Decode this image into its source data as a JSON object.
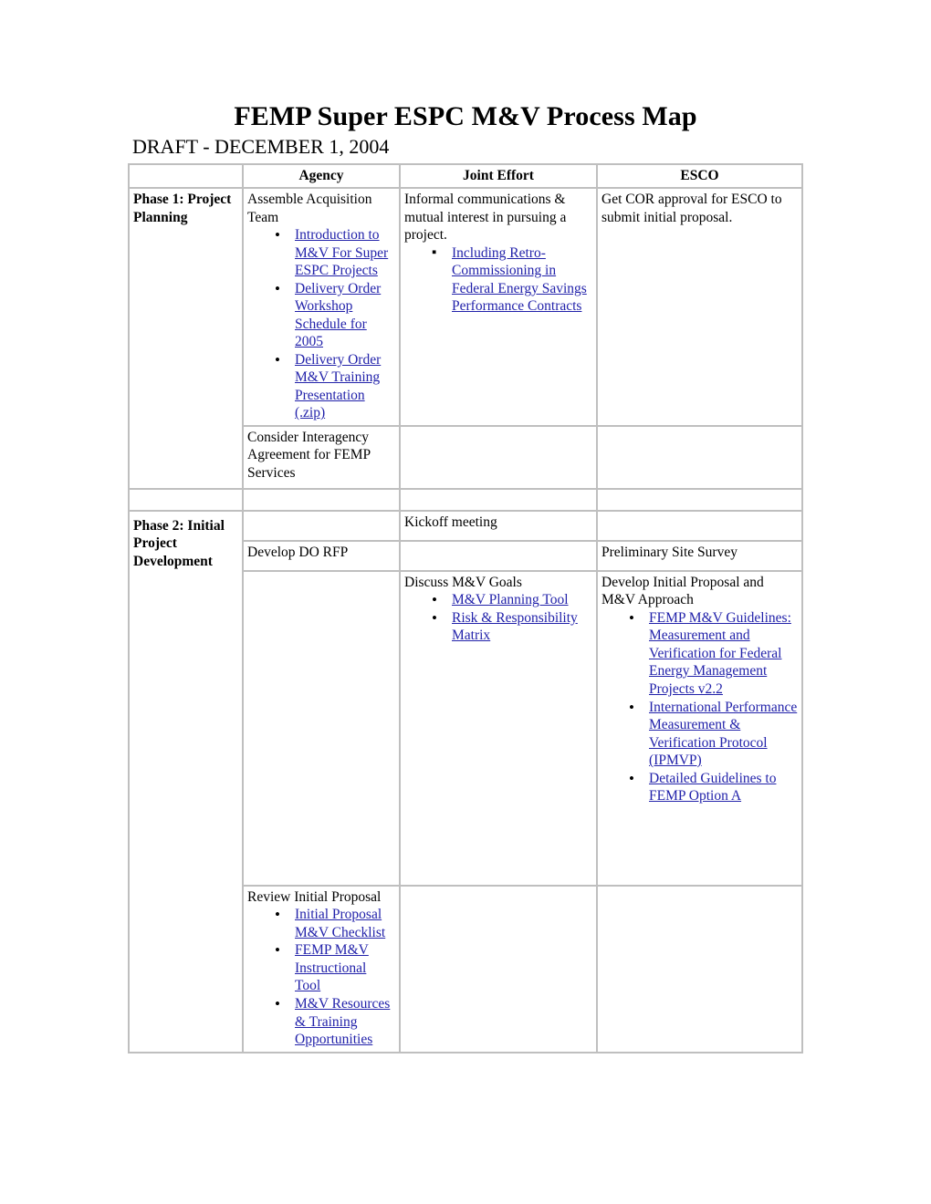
{
  "document": {
    "title": "FEMP Super ESPC M&V Process Map",
    "subtitle": "DRAFT - DECEMBER 1, 2004"
  },
  "colors": {
    "joint_effort_fill": "#ccffff",
    "divider_fill": "#c0c0c0",
    "link": "#2222aa",
    "border": "#bfbfbf"
  },
  "table": {
    "headers": {
      "phase": "",
      "agency": "Agency",
      "joint": "Joint Effort",
      "esco": "ESCO"
    },
    "phase1": {
      "label": "Phase 1: Project Planning",
      "row1": {
        "agency": {
          "heading": "Assemble Acquisition Team",
          "bullets": [
            "Introduction to M&V For Super ESPC Projects",
            "Delivery Order Workshop Schedule for 2005",
            "Delivery Order M&V Training Presentation (.zip)"
          ]
        },
        "joint": {
          "heading": "Informal communications & mutual interest in pursuing a project.",
          "bullets": [
            "Including Retro-Commissioning in Federal Energy Savings Performance Contracts"
          ]
        },
        "esco": {
          "heading": "Get COR approval for ESCO to submit initial proposal.",
          "bullets": []
        }
      },
      "row2": {
        "agency": {
          "heading": "Consider Interagency Agreement for FEMP Services",
          "bullets": []
        },
        "joint": {
          "heading": "",
          "bullets": []
        },
        "esco": {
          "heading": "",
          "bullets": []
        }
      }
    },
    "phase2": {
      "label": "Phase 2: Initial Project Development",
      "row1": {
        "agency": {
          "heading": "",
          "bullets": []
        },
        "joint": {
          "heading": "Kickoff meeting",
          "bullets": []
        },
        "esco": {
          "heading": "",
          "bullets": []
        }
      },
      "row2": {
        "agency": {
          "heading": "Develop DO RFP",
          "bullets": []
        },
        "joint": {
          "heading": "",
          "bullets": []
        },
        "esco": {
          "heading": "Preliminary Site Survey",
          "bullets": []
        }
      },
      "row3": {
        "agency": {
          "heading": "",
          "bullets": []
        },
        "joint": {
          "heading": "Discuss M&V Goals",
          "bullets": [
            "M&V Planning Tool",
            "Risk & Responsibility Matrix"
          ]
        },
        "esco": {
          "heading": "Develop Initial Proposal and M&V Approach",
          "bullets": [
            "FEMP M&V Guidelines: Measurement and Verification for Federal Energy Management Projects v2.2",
            "International Performance Measurement & Verification Protocol (IPMVP)",
            "Detailed Guidelines to FEMP Option A"
          ]
        }
      },
      "row4": {
        "agency": {
          "heading": "Review Initial Proposal",
          "bullets": [
            "Initial Proposal M&V Checklist",
            "FEMP M&V Instructional Tool",
            "M&V Resources & Training Opportunities"
          ]
        },
        "joint": {
          "heading": "",
          "bullets": []
        },
        "esco": {
          "heading": "",
          "bullets": []
        }
      }
    }
  }
}
